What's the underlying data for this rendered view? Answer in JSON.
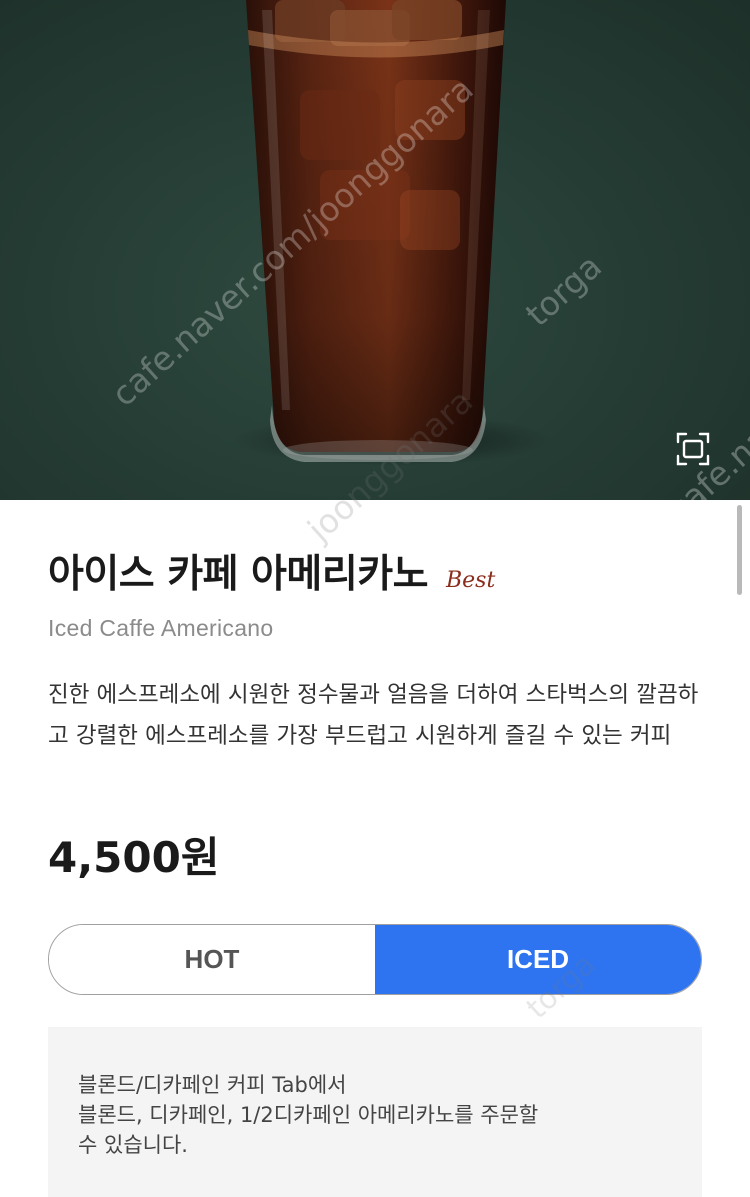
{
  "hero": {
    "watermarks": [
      "cafe.naver.com/joonggonara",
      "torga",
      "cafe.naver",
      "joonggonara",
      "torga"
    ]
  },
  "product": {
    "name_ko": "아이스 카페 아메리카노",
    "badge": "Best",
    "name_en": "Iced Caffe Americano",
    "description": "진한 에스프레소에 시원한 정수물과 얼음을 더하여 스타벅스의 깔끔하고 강렬한 에스프레소를 가장 부드럽고 시원하게 즐길 수 있는 커피",
    "price": "4,500원"
  },
  "temperature": {
    "options": [
      "HOT",
      "ICED"
    ],
    "selected": "ICED"
  },
  "notice": {
    "lines": [
      "블론드/디카페인 커피 Tab에서",
      "블론드, 디카페인, 1/2디카페인 아메리카노를 주문할",
      "수 있습니다."
    ]
  },
  "colors": {
    "accent": "#2e74f0",
    "badge": "#8a2d1c",
    "hero_background": "#243b33"
  },
  "icons": {
    "expand": "expand-icon"
  }
}
